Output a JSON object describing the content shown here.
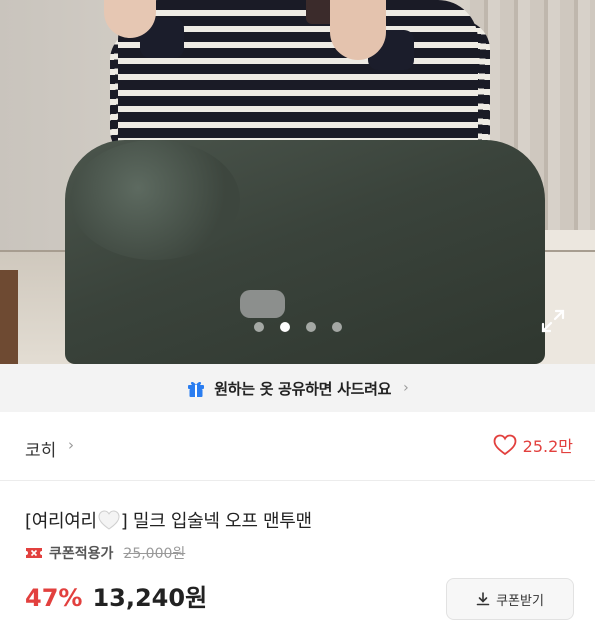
{
  "hero": {
    "slides_count": 4,
    "active_slide": 2
  },
  "banner": {
    "text": "원하는 옷 공유하면 사드려요",
    "chevron": "›",
    "icon": "gift-icon"
  },
  "seller": {
    "name": "코히",
    "chevron": "›",
    "likes": "25.2만"
  },
  "product": {
    "title_prefix": "[여리여리",
    "title_suffix": "] 밀크 입술넥 오프 맨투맨",
    "coupon_label": "쿠폰적용가",
    "original_price": "25,000원",
    "discount": "47%",
    "price": "13,240원",
    "coupon_button_label": "쿠폰받기"
  },
  "colors": {
    "accent": "#e2403e",
    "banner_bg": "#f3f3f3",
    "gift_icon": "#2a7df0"
  }
}
